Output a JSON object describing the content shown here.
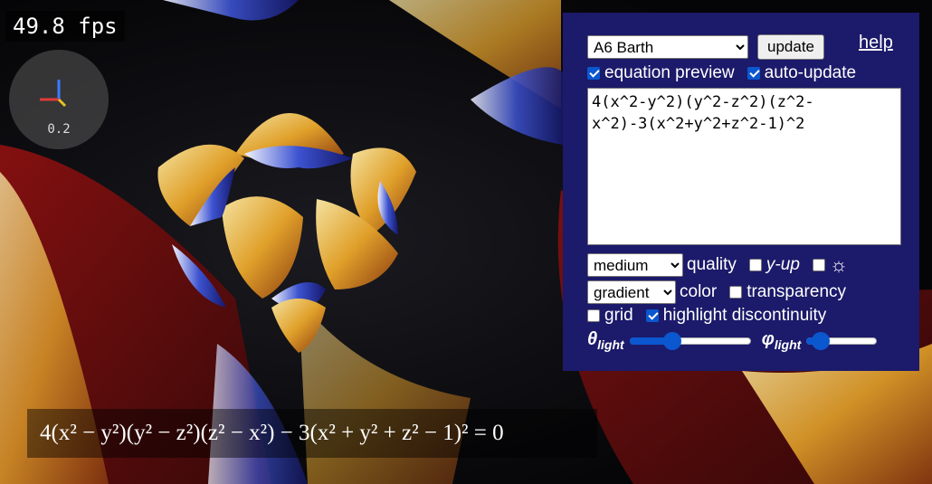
{
  "fps": "49.8 fps",
  "axes": {
    "scale": "0.2"
  },
  "panel": {
    "surface_select": {
      "selected": "A6 Barth"
    },
    "update_label": "update",
    "help_label": "help",
    "equation_preview": {
      "label": "equation preview",
      "checked": true
    },
    "auto_update": {
      "label": "auto-update",
      "checked": true
    },
    "equation_text": "4(x^2-y^2)(y^2-z^2)(z^2-x^2)-3(x^2+y^2+z^2-1)^2",
    "quality_select": {
      "selected": "medium"
    },
    "quality_label": "quality",
    "y_up": {
      "label": "y-up",
      "checked": false
    },
    "light_toggle": {
      "icon": "sun-icon",
      "checked": false
    },
    "color_select": {
      "selected": "gradient"
    },
    "color_label": "color",
    "transparency": {
      "label": "transparency",
      "checked": false
    },
    "grid": {
      "label": "grid",
      "checked": false
    },
    "highlight_discontinuity": {
      "label": "highlight discontinuity",
      "checked": true
    },
    "theta_light": {
      "symbol": "θ",
      "sub": "light",
      "value": 0.35
    },
    "phi_light": {
      "symbol": "φ",
      "sub": "light",
      "value": 0.2
    }
  },
  "formula_display": "4(x² − y²)(y² − z²)(z² − x²) − 3(x² + y² + z² − 1)² = 0",
  "colors": {
    "panel_bg": "#1c1a6a",
    "accent": "#0b57d0",
    "surface_orange": "#e0a02a",
    "surface_blue": "#2a3ec0"
  }
}
